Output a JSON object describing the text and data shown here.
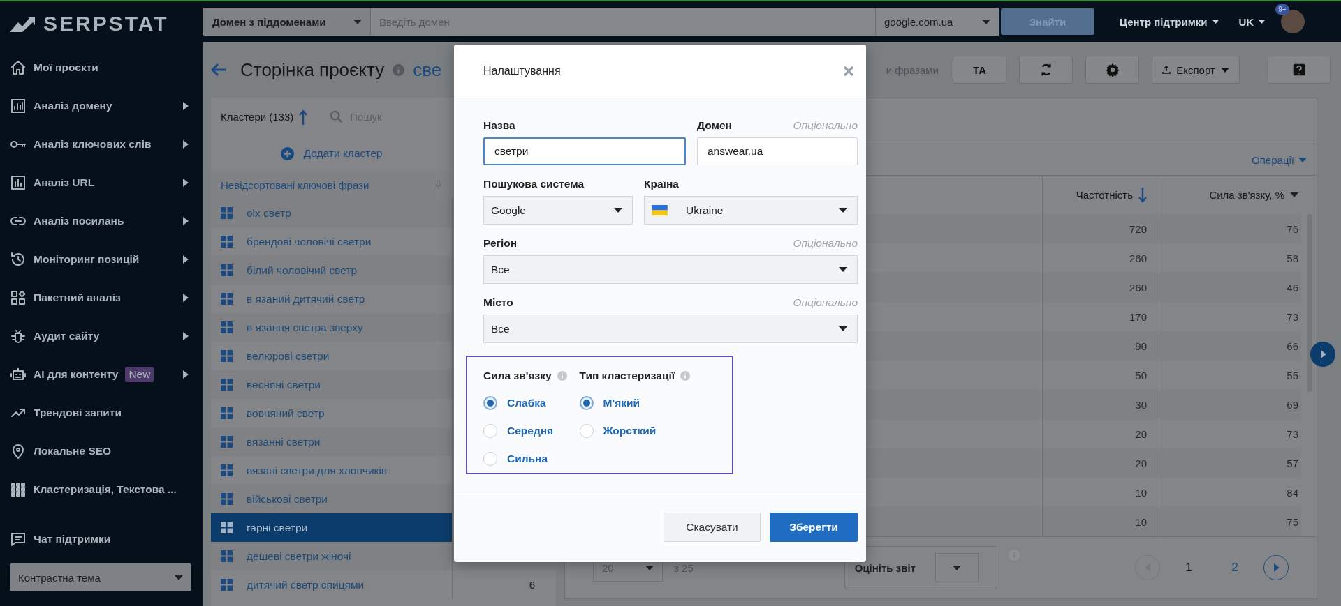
{
  "sidebar": {
    "logo": "SERPSTAT",
    "items": [
      {
        "label": "Мої проєкти",
        "expandable": false
      },
      {
        "label": "Аналіз домену",
        "expandable": true
      },
      {
        "label": "Аналіз ключових слів",
        "expandable": true
      },
      {
        "label": "Аналіз URL",
        "expandable": true
      },
      {
        "label": "Аналіз посилань",
        "expandable": true
      },
      {
        "label": "Моніторинг позицій",
        "expandable": true
      },
      {
        "label": "Пакетний аналіз",
        "expandable": true
      },
      {
        "label": "Аудит сайту",
        "expandable": true
      },
      {
        "label": "AI для контенту",
        "expandable": true,
        "badge": "New"
      },
      {
        "label": "Трендові запити",
        "expandable": false
      },
      {
        "label": "Локальне SEO",
        "expandable": false
      },
      {
        "label": "Кластеризація, Текстова ...",
        "expandable": false
      }
    ],
    "support": "Чат підтримки",
    "theme_select": "Контрастна тема"
  },
  "topbar": {
    "search_type": "Домен з піддоменами",
    "domain_placeholder": "Введіть домен",
    "engine": "google.com.ua",
    "search_button": "Знайти",
    "support_center": "Центр підтримки",
    "language": "UK",
    "notification_badge": "9+"
  },
  "page": {
    "title": "Сторінка проєкту",
    "title_fragment": "све",
    "tab_fragment": "и фразами",
    "toolbar": [
      {
        "kind": "text",
        "label": "ТА"
      },
      {
        "kind": "refresh"
      },
      {
        "kind": "settings"
      },
      {
        "kind": "export",
        "label": "Експорт"
      },
      {
        "kind": "help"
      }
    ]
  },
  "clusters": {
    "title": "Кластери (133)",
    "search_placeholder": "Пошук",
    "add_label": "Додати кластер",
    "unsorted": "Невідсортовані ключові фрази",
    "items": [
      {
        "label": "olx светр",
        "selected": false
      },
      {
        "label": "брендові чоловічі светри",
        "selected": false
      },
      {
        "label": "білий чоловічий светр",
        "selected": false
      },
      {
        "label": "в язаний дитячий светр",
        "selected": false
      },
      {
        "label": "в язання светра зверху",
        "selected": false
      },
      {
        "label": "велюрові светри",
        "selected": false
      },
      {
        "label": "весняні светри",
        "selected": false
      },
      {
        "label": "вовняний светр",
        "selected": false
      },
      {
        "label": "вязанні светри",
        "selected": false
      },
      {
        "label": "вязані светри для хлопчиків",
        "selected": false
      },
      {
        "label": "військові светри",
        "selected": false
      },
      {
        "label": "гарні светри",
        "selected": true
      },
      {
        "label": "дешеві светри жіночі",
        "selected": false
      },
      {
        "label": "дитячий светр спицями",
        "selected": false,
        "count": "6"
      }
    ]
  },
  "table": {
    "operations": "Операції",
    "columns": [
      {
        "label": "Частотність",
        "sorted": true
      },
      {
        "label": "Сила зв'язку, %",
        "sorted": false
      }
    ],
    "rows": [
      {
        "frequency": "720",
        "strength": "76"
      },
      {
        "frequency": "260",
        "strength": "58"
      },
      {
        "frequency": "260",
        "strength": "46"
      },
      {
        "frequency": "170",
        "strength": "73"
      },
      {
        "frequency": "90",
        "strength": "66"
      },
      {
        "frequency": "50",
        "strength": "55"
      },
      {
        "frequency": "30",
        "strength": "69"
      },
      {
        "frequency": "20",
        "strength": "73"
      },
      {
        "frequency": "20",
        "strength": "57"
      },
      {
        "frequency": "10",
        "strength": "84"
      },
      {
        "frequency": "10",
        "strength": "75"
      }
    ],
    "footer": {
      "per_page": "20",
      "total": "з 25",
      "rate_label": "Оцініть звіт",
      "pages": [
        {
          "label": "1",
          "selected": true
        },
        {
          "label": "2",
          "selected": false
        }
      ]
    }
  },
  "modal": {
    "title": "Налаштування",
    "name": {
      "label": "Назва",
      "value": "светри",
      "focused": true
    },
    "domain": {
      "label": "Домен",
      "hint": "Опціонально",
      "value": "answear.ua"
    },
    "engine": {
      "label": "Пошукова система",
      "value": "Google"
    },
    "country": {
      "label": "Країна",
      "value": "Ukraine"
    },
    "region": {
      "label": "Регіон",
      "hint": "Опціонально",
      "value": "Все"
    },
    "city": {
      "label": "Місто",
      "hint": "Опціонально",
      "value": "Все"
    },
    "radio_groups": [
      {
        "title": "Сила зв'язку",
        "options": [
          {
            "label": "Слабка",
            "selected": true
          },
          {
            "label": "Середня",
            "selected": false
          },
          {
            "label": "Сильна",
            "selected": false
          }
        ]
      },
      {
        "title": "Тип кластеризації",
        "options": [
          {
            "label": "М'який",
            "selected": true
          },
          {
            "label": "Жорсткий",
            "selected": false
          }
        ]
      }
    ],
    "cancel": "Скасувати",
    "save": "Зберегти"
  }
}
